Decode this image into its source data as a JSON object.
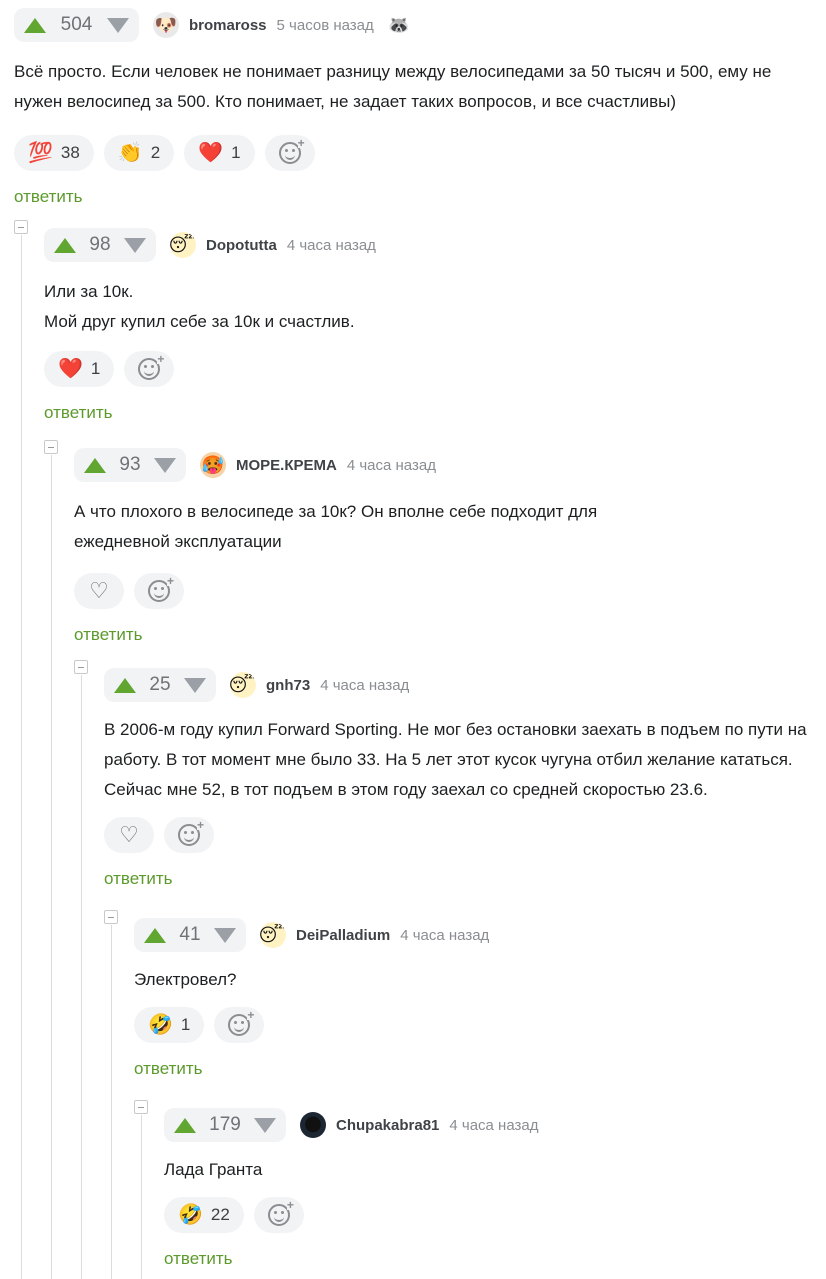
{
  "comments": [
    {
      "rating": "504",
      "author": "bromaross",
      "time": "5 часов назад",
      "avatar": "🐶",
      "badge": "🦝",
      "text": "Всё просто. Если человек не понимает разницу между велосипедами за 50 тысяч и 500, ему не нужен велосипед за 500. Кто понимает, не задает таких вопросов, и все счастливы)",
      "reactions": [
        {
          "emoji": "💯",
          "count": "38"
        },
        {
          "emoji": "👏",
          "count": "2"
        },
        {
          "emoji": "❤️",
          "count": "1"
        }
      ],
      "reply": "ответить"
    },
    {
      "rating": "98",
      "author": "Dopotutta",
      "time": "4 часа назад",
      "avatar": "😴",
      "text": "Или за 10к.\nМой друг купил себе за 10к и счастлив.",
      "reactions": [
        {
          "emoji": "❤️",
          "count": "1"
        }
      ],
      "reply": "ответить"
    },
    {
      "rating": "93",
      "author": "МОРЕ.КРЕМА",
      "time": "4 часа назад",
      "avatar": "🥵",
      "text": "А что плохого в велосипеде за 10к? Он вполне себе подходит для\nежедневной эксплуатации",
      "reactions": [
        {
          "emoji": "♡",
          "count": ""
        }
      ],
      "reply": "ответить"
    },
    {
      "rating": "25",
      "author": "gnh73",
      "time": "4 часа назад",
      "avatar": "😴",
      "text": "В 2006-м году купил Forward Sporting. Не мог без остановки заехать в подъем по пути на работу. В тот момент мне было 33. На 5 лет этот кусок чугуна отбил желание кататься. Сейчас мне 52, в тот подъем в этом году заехал со средней скоростью 23.6.",
      "reactions": [
        {
          "emoji": "♡",
          "count": ""
        }
      ],
      "reply": "ответить"
    },
    {
      "rating": "41",
      "author": "DeiPalladium",
      "time": "4 часа назад",
      "avatar": "😴",
      "text": "Электровел?",
      "reactions": [
        {
          "emoji": "🤣",
          "count": "1"
        }
      ],
      "reply": "ответить"
    },
    {
      "rating": "179",
      "author": "Chupakabra81",
      "time": "4 часа назад",
      "avatar": "🌑",
      "text": "Лада Гранта",
      "reactions": [
        {
          "emoji": "🤣",
          "count": "22"
        }
      ],
      "reply": "ответить"
    }
  ]
}
